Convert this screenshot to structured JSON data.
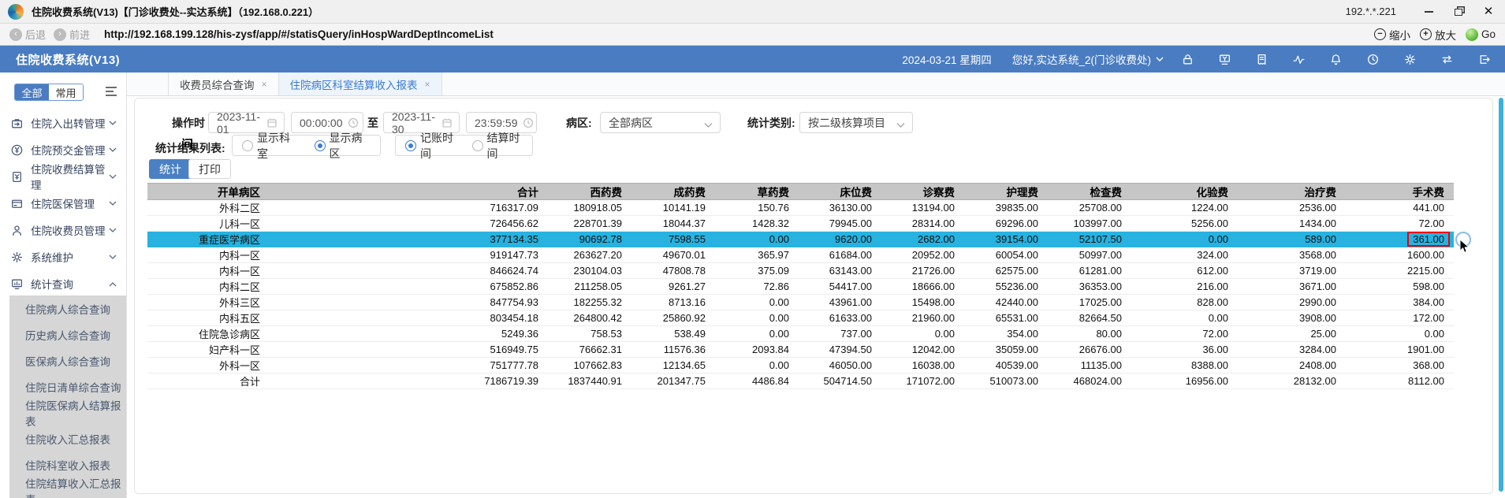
{
  "window": {
    "title": "住院收费系统(V13)【门诊收费处--实达系统】（192.168.0.221）",
    "ip": "192.*.*.221"
  },
  "address_bar": {
    "back_label": "后退",
    "forward_label": "前进",
    "url": "http://192.168.199.128/his-zysf/app/#/statisQuery/inHospWardDeptIncomeList",
    "zoom_out_label": "缩小",
    "zoom_in_label": "放大",
    "go_label": "Go"
  },
  "app_bar": {
    "title": "住院收费系统(V13)",
    "date": "2024-03-21 星期四",
    "user": "您好,实达系统_2(门诊收费处)",
    "icons": [
      "lock",
      "pos-terminal",
      "receipt",
      "activity",
      "bell",
      "clock",
      "gear",
      "swap",
      "logout"
    ],
    "accent_color": "#4a7cc2"
  },
  "tabs": [
    {
      "label": "收费员综合查询",
      "active": false
    },
    {
      "label": "住院病区科室结算收入报表",
      "active": true
    }
  ],
  "sidebar": {
    "segment": {
      "all": "全部",
      "common": "常用",
      "active": "全部"
    },
    "menu": [
      {
        "label": "住院入出转管理",
        "icon": "transfer",
        "expanded": false
      },
      {
        "label": "住院预交金管理",
        "icon": "prepay",
        "expanded": false
      },
      {
        "label": "住院收费结算管理",
        "icon": "settle",
        "expanded": false
      },
      {
        "label": "住院医保管理",
        "icon": "insurance",
        "expanded": false
      },
      {
        "label": "住院收费员管理",
        "icon": "cashier",
        "expanded": false
      },
      {
        "label": "系统维护",
        "icon": "maintain",
        "expanded": false
      },
      {
        "label": "统计查询",
        "icon": "statis",
        "expanded": true
      }
    ],
    "submenu": [
      "住院病人综合查询",
      "历史病人综合查询",
      "医保病人综合查询",
      "住院日清单综合查询",
      "住院医保病人结算报表",
      "住院收入汇总报表",
      "住院科室收入报表",
      "住院结算收入汇总报表"
    ]
  },
  "filters": {
    "op_time_label": "操作时间",
    "date_from": "2023-11-01",
    "time_from": "00:00:00",
    "to_label": "至",
    "date_to": "2023-11-30",
    "time_to": "23:59:59",
    "ward_label": "病区:",
    "ward_value": "全部病区",
    "stat_type_label": "统计类别:",
    "stat_type_value": "按二级核算项目",
    "result_list_label": "统计结果列表:",
    "radio_group_display": [
      {
        "label": "显示科室",
        "checked": false
      },
      {
        "label": "显示病区",
        "checked": true
      }
    ],
    "radio_group_time": [
      {
        "label": "记账时间",
        "checked": true
      },
      {
        "label": "结算时间",
        "checked": false
      }
    ],
    "stat_button": "统计",
    "print_button": "打印"
  },
  "table": {
    "columns": [
      "开单病区",
      "合计",
      "西药费",
      "成药费",
      "草药费",
      "床位费",
      "诊察费",
      "护理费",
      "检查费",
      "化验费",
      "治疗费",
      "手术费"
    ],
    "rows": [
      [
        "外科二区",
        "716317.09",
        "180918.05",
        "10141.19",
        "150.76",
        "36130.00",
        "13194.00",
        "39835.00",
        "25708.00",
        "1224.00",
        "2536.00",
        "441.00"
      ],
      [
        "儿科一区",
        "726456.62",
        "228701.39",
        "18044.37",
        "1428.32",
        "79945.00",
        "28314.00",
        "69296.00",
        "103997.00",
        "5256.00",
        "1434.00",
        "72.00"
      ],
      [
        "重症医学病区",
        "377134.35",
        "90692.78",
        "7598.55",
        "0.00",
        "9620.00",
        "2682.00",
        "39154.00",
        "52107.50",
        "0.00",
        "589.00",
        "361.00"
      ],
      [
        "内科一区",
        "919147.73",
        "263627.20",
        "49670.01",
        "365.97",
        "61684.00",
        "20952.00",
        "60054.00",
        "50997.00",
        "324.00",
        "3568.00",
        "1600.00"
      ],
      [
        "内科一区",
        "846624.74",
        "230104.03",
        "47808.78",
        "375.09",
        "63143.00",
        "21726.00",
        "62575.00",
        "61281.00",
        "612.00",
        "3719.00",
        "2215.00"
      ],
      [
        "内科二区",
        "675852.86",
        "211258.05",
        "9261.27",
        "72.86",
        "54417.00",
        "18666.00",
        "55236.00",
        "36353.00",
        "216.00",
        "3671.00",
        "598.00"
      ],
      [
        "外科三区",
        "847754.93",
        "182255.32",
        "8713.16",
        "0.00",
        "43961.00",
        "15498.00",
        "42440.00",
        "17025.00",
        "828.00",
        "2990.00",
        "384.00"
      ],
      [
        "内科五区",
        "803454.18",
        "264800.42",
        "25860.92",
        "0.00",
        "61633.00",
        "21960.00",
        "65531.00",
        "82664.50",
        "0.00",
        "3908.00",
        "172.00"
      ],
      [
        "住院急诊病区",
        "5249.36",
        "758.53",
        "538.49",
        "0.00",
        "737.00",
        "0.00",
        "354.00",
        "80.00",
        "72.00",
        "25.00",
        "0.00"
      ],
      [
        "妇产科一区",
        "516949.75",
        "76662.31",
        "11576.36",
        "2093.84",
        "47394.50",
        "12042.00",
        "35059.00",
        "26676.00",
        "36.00",
        "3284.00",
        "1901.00"
      ],
      [
        "外科一区",
        "751777.78",
        "107662.83",
        "12134.65",
        "0.00",
        "46050.00",
        "16038.00",
        "40539.00",
        "11135.00",
        "8388.00",
        "2408.00",
        "368.00"
      ],
      [
        "合计",
        "7186719.39",
        "1837440.91",
        "201347.75",
        "4486.84",
        "504714.50",
        "171072.00",
        "510073.00",
        "468024.00",
        "16956.00",
        "28132.00",
        "8112.00"
      ]
    ],
    "highlight_row_index": 2,
    "highlight_color": "#27b2e0",
    "boxed_cell": {
      "row": 2,
      "col": 11,
      "border_color": "#ee0000"
    }
  }
}
